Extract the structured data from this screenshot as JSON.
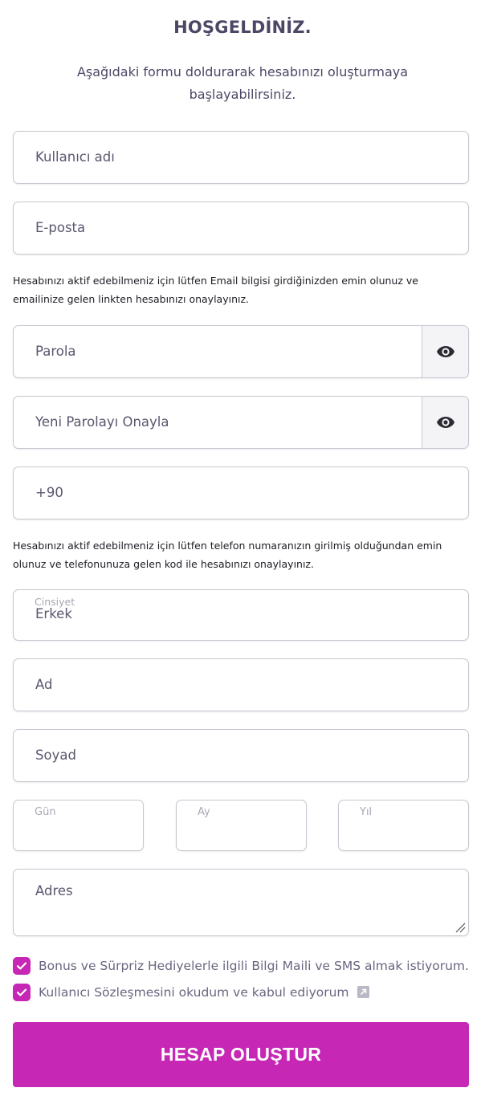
{
  "header": {
    "title": "HOŞGELDİNİZ.",
    "subtitle": "Aşağıdaki formu doldurarak hesabınızı oluşturmaya başlayabilirsiniz."
  },
  "form": {
    "username_placeholder": "Kullanıcı adı",
    "email_placeholder": "E-posta",
    "email_note": "Hesabınızı aktif edebilmeniz için lütfen Email bilgisi girdiğinizden emin olunuz ve emailinize gelen linkten hesabınızı onaylayınız.",
    "password_placeholder": "Parola",
    "confirm_password_placeholder": "Yeni Parolayı Onayla",
    "phone_value": "+90",
    "phone_note": "Hesabınızı aktif edebilmeniz için lütfen telefon numaranızın girilmiş olduğundan emin olunuz ve telefonunuza gelen kod ile hesabınızı onaylayınız.",
    "gender_label": "Cinsiyet",
    "gender_value": "Erkek",
    "first_name_placeholder": "Ad",
    "last_name_placeholder": "Soyad",
    "day_label": "Gün",
    "month_label": "Ay",
    "year_label": "Yıl",
    "address_placeholder": "Adres",
    "checkbox_bonus_label": "Bonus ve Sürpriz Hediyelerle ilgili Bilgi Maili ve SMS almak istiyorum.",
    "checkbox_bonus_checked": true,
    "checkbox_terms_label": "Kullanıcı Sözleşmesini okudum ve kabul ediyorum",
    "checkbox_terms_checked": true,
    "submit_label": "HESAP OLUŞTUR"
  },
  "icons": {
    "password_toggle": "eye-icon",
    "confirm_toggle": "eye-icon",
    "checkbox": "checkmark-icon",
    "terms_link": "external-link-icon",
    "resize": "resize-handle-icon"
  },
  "colors": {
    "accent": "#c627b5",
    "title": "#4d4766",
    "border": "#c8c6d0",
    "placeholder": "#5a566e"
  }
}
